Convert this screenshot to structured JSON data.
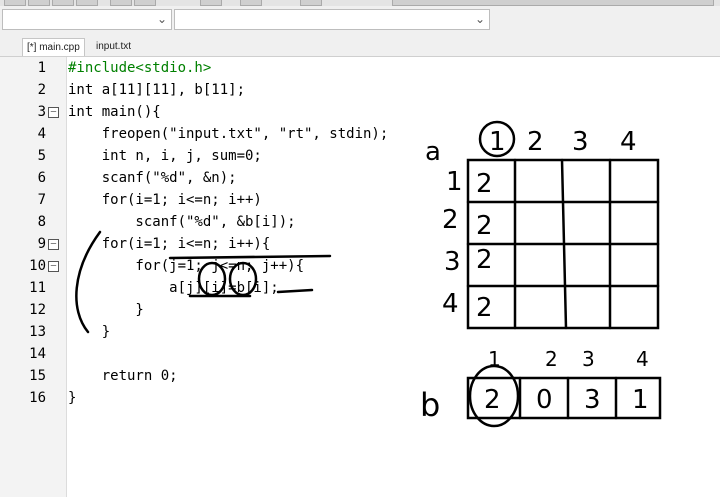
{
  "tabs": [
    {
      "label": "[*] main.cpp",
      "active": true
    },
    {
      "label": "input.txt",
      "active": false
    }
  ],
  "line_numbers": [
    "1",
    "2",
    "3",
    "4",
    "5",
    "6",
    "7",
    "8",
    "9",
    "10",
    "11",
    "12",
    "13",
    "14",
    "15",
    "16"
  ],
  "code": {
    "l1": "#include<stdio.h>",
    "l2": "int a[11][11], b[11];",
    "l3": "int main(){",
    "l4": "    freopen(\"input.txt\", \"rt\", stdin);",
    "l5": "    int n, i, j, sum=0;",
    "l6": "    scanf(\"%d\", &n);",
    "l7": "    for(i=1; i<=n; i++)",
    "l8": "        scanf(\"%d\", &b[i]);",
    "l9": "    for(i=1; i<=n; i++){",
    "l10": "        for(j=1; j<=n; j++){",
    "l11": "            a[j][i]=b[i];",
    "l12": "        }",
    "l13": "    }",
    "l14": "",
    "l15": "    return 0;",
    "l16": "}"
  },
  "drawing": {
    "label_a": "a",
    "label_b": "b",
    "a_cols": [
      "1",
      "2",
      "3",
      "4"
    ],
    "a_rows": [
      "1",
      "2",
      "3",
      "4"
    ],
    "a_cells": [
      "2",
      "2",
      "2",
      "2"
    ],
    "b_cols": [
      "1",
      "2",
      "3",
      "4"
    ],
    "b_cells": [
      "2",
      "0",
      "3",
      "1"
    ]
  },
  "colors": {
    "keyword": "#000000",
    "preprocessor": "#008000",
    "string": "#0000ff",
    "number": "#ff00ff",
    "operator": "#ff0000",
    "ink": "#000000"
  }
}
